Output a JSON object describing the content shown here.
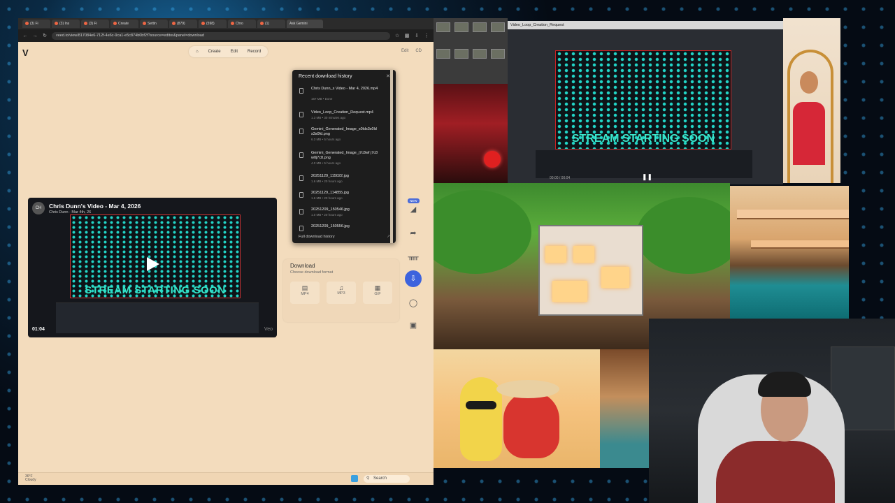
{
  "browser": {
    "tabs": [
      "(3) Fi",
      "(3) Ins",
      "(3) Fi",
      "Create",
      "Settin",
      "(879)",
      "(598)",
      "Chro",
      "(1)"
    ],
    "ask_gemini": "Ask Gemini",
    "url": "veed.io/view/817084e6-712f-4e6c-9ca1-e5c874b0bf2f?source=editor&panel=download"
  },
  "app": {
    "logo": "V",
    "nav": {
      "create": "Create",
      "edit": "Edit",
      "record": "Record"
    },
    "right_nav": {
      "edit": "Edit",
      "cd": "CD"
    }
  },
  "video": {
    "avatar": "CH",
    "title": "Chris Dunn's Video - Mar 4, 2026",
    "subtitle": "Chris Dunn · Mar 4th, 26",
    "overlay_text": "STREAM STARTING SOON",
    "duration": "01:04",
    "watermark": "Veo"
  },
  "downloads": {
    "title": "Recent download history",
    "items": [
      {
        "name": "Chris Dunn_s Video - Mar 4, 2026.mp4",
        "meta": "167 MB • Done"
      },
      {
        "name": "Video_Loop_Creation_Request.mp4",
        "meta": "1.3 MB • 30 minutes ago"
      },
      {
        "name": "Gemini_Generated_Image_s0lds3s0ld s3s0fd.png",
        "meta": "6.3 MB • 5 hours ago"
      },
      {
        "name": "Gemini_Generated_Image_j7c8wf j7c8 w0j7c8.png",
        "meta": "4.0 MB • 5 hours ago"
      },
      {
        "name": "20251129_115022.jpg",
        "meta": "1.6 MB • 20 hours ago"
      },
      {
        "name": "20251129_114855.jpg",
        "meta": "1.6 MB • 20 hours ago"
      },
      {
        "name": "20251209_150546.jpg",
        "meta": "1.0 MB • 20 hours ago"
      },
      {
        "name": "20251209_150556.jpg",
        "meta": ""
      }
    ],
    "footer": "Full download history"
  },
  "download_panel": {
    "title": "Download",
    "subtitle": "Choose download format",
    "formats": [
      "MP4",
      "MP3",
      "GIF"
    ]
  },
  "sidebar": {
    "new_badge": "NEW"
  },
  "taskbar": {
    "weather_temp": "36°F",
    "weather_desc": "Cloudy",
    "search": "Search"
  },
  "obs": {
    "window_title": "Video_Loop_Creation_Request",
    "overlay_text": "STREAM STARTING SOON",
    "timecode": "00:00 / 00:04"
  },
  "colors": {
    "page_bg": "#f3dcbd",
    "accent": "#3d63dd",
    "overlay_text": "#37e5c9",
    "record_red": "#e02020"
  }
}
